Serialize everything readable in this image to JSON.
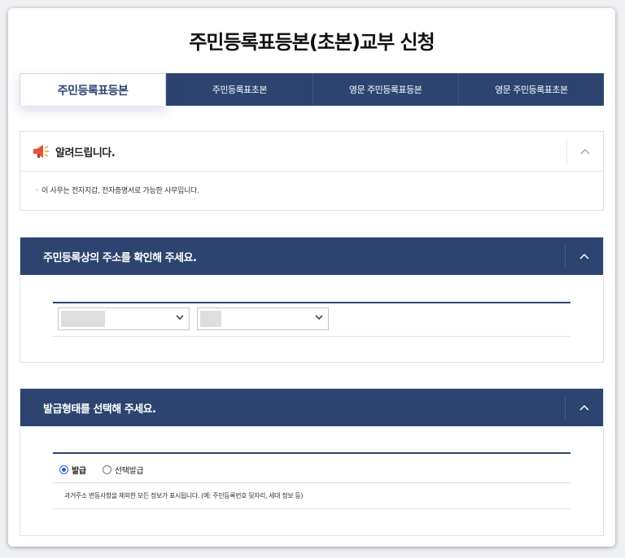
{
  "page": {
    "title": "주민등록표등본(초본)교부 신청"
  },
  "tabs": [
    {
      "label": "주민등록표등본",
      "active": true
    },
    {
      "label": "주민등록표초본",
      "active": false
    },
    {
      "label": "영문 주민등록표등본",
      "active": false
    },
    {
      "label": "영문 주민등록표초본",
      "active": false
    }
  ],
  "notice": {
    "title": "알려드립니다.",
    "icon": "megaphone-icon",
    "text": "이 사무는 전자지갑, 전자증명서로 가능한 사무입니다."
  },
  "address_section": {
    "title": "주민등록상의 주소를 확인해 주세요."
  },
  "issue_section": {
    "title": "발급형태를 선택해 주세요.",
    "options": [
      {
        "label": "발급",
        "selected": true
      },
      {
        "label": "선택발급",
        "selected": false
      }
    ],
    "description": "과거주소 변동사항을 제외한 모든 정보가 표시됩니다. (예: 주민등록번호 뒷자리, 세대 정보 등)"
  },
  "colors": {
    "primary": "#2d4470",
    "radio": "#2d5dd7"
  }
}
